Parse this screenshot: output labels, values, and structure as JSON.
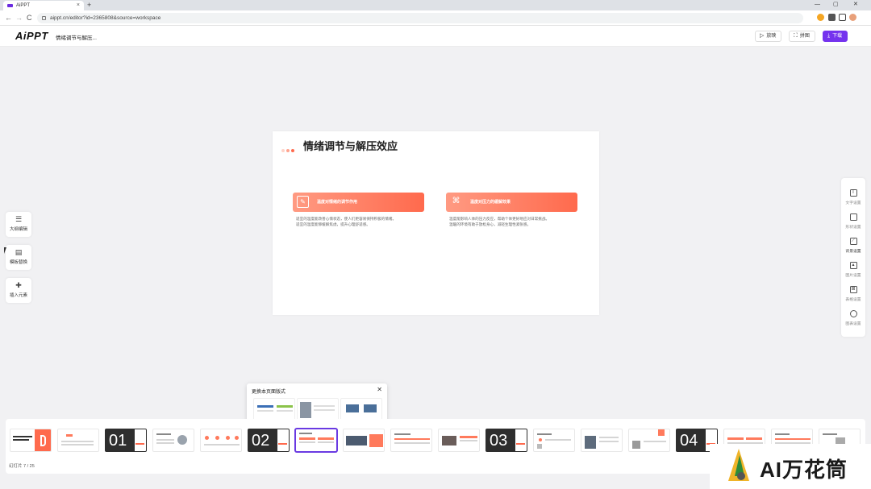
{
  "browser": {
    "tab_title": "AiPPT",
    "new_tab": "+",
    "url": "aippt.cn/editor?id=2365808&source=workspace",
    "back": "←",
    "forward": "→",
    "reload": "C",
    "win_min": "—",
    "win_max": "▢",
    "win_close": "✕"
  },
  "header": {
    "logo": "AiPPT",
    "doc_title": "情绪调节与解压...",
    "present_label": "放映",
    "jigsaw_label": "拼图",
    "download_label": "下载",
    "accent": "#7533ee"
  },
  "slide": {
    "title": "情绪调节与解压效应",
    "cards": [
      {
        "icon": "leaf-icon",
        "heading": "温度对情绪的调节作用",
        "body_1": "适宜的温度能改善心情状态，使人们更容易保持积极的情绪。",
        "body_2": "适宜的温度能够缓解焦虑，提升心理舒适感。"
      },
      {
        "icon": "grid-icon",
        "heading": "温度对压力的缓解效果",
        "body_1": "温度能影响人体的压力反应，帮助个体更好地应对日常挑战。",
        "body_2": "温暖的环境有助于放松身心，减轻生理性紧张感。"
      }
    ],
    "accent": "#ff6a4d"
  },
  "left_tools": [
    {
      "icon": "outline-icon",
      "label": "大纲编辑"
    },
    {
      "icon": "template-icon",
      "label": "模板替换"
    },
    {
      "icon": "insert-icon",
      "label": "插入元素"
    }
  ],
  "right_tools": [
    {
      "icon": "text-icon",
      "label": "文字设置"
    },
    {
      "icon": "shape-icon",
      "label": "形状设置"
    },
    {
      "icon": "background-icon",
      "label": "背景设置"
    },
    {
      "icon": "image-icon",
      "label": "图片设置"
    },
    {
      "icon": "table-icon",
      "label": "表格设置"
    },
    {
      "icon": "chart-icon",
      "label": "图表设置"
    }
  ],
  "popup": {
    "title": "更换本页面版式",
    "close": "✕"
  },
  "filmstrip": {
    "page_info": "幻灯片 7 / 25",
    "chapters": [
      "01",
      "02",
      "03",
      "04"
    ]
  },
  "watermark": {
    "text": "AI万花筒"
  }
}
